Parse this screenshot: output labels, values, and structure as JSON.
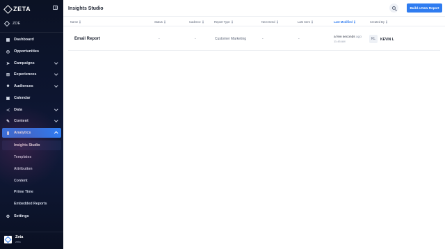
{
  "brand": {
    "name": "ZETA"
  },
  "workspace": {
    "name": "ZOE"
  },
  "sidebar": {
    "items": [
      {
        "label": "Dashboard",
        "icon": "grid-icon"
      },
      {
        "label": "Opportunities",
        "icon": "target-icon"
      },
      {
        "label": "Campaigns",
        "icon": "send-icon"
      },
      {
        "label": "Experiences",
        "icon": "hierarchy-icon"
      },
      {
        "label": "Audiences",
        "icon": "users-icon"
      },
      {
        "label": "Calendar",
        "icon": "calendar-icon"
      },
      {
        "label": "Data",
        "icon": "share-icon"
      },
      {
        "label": "Content",
        "icon": "content-icon"
      },
      {
        "label": "Analytics",
        "icon": "bar-chart-icon"
      },
      {
        "label": "Settings",
        "icon": "gear-icon"
      }
    ],
    "sub_items": [
      {
        "label": "Insights Studio"
      },
      {
        "label": "Templates"
      },
      {
        "label": "Attribution"
      },
      {
        "label": "Content"
      },
      {
        "label": "Prime Time"
      },
      {
        "label": "Embedded Reports"
      }
    ],
    "footer": {
      "name": "Zeta",
      "sub": "zeta"
    }
  },
  "header": {
    "title": "Insights Studio",
    "build_label": "Build a New Report"
  },
  "table": {
    "columns": [
      "Name",
      "Status",
      "Cadence",
      "Report Type",
      "Next Send",
      "Last Sent",
      "Last Modified",
      "Created By"
    ],
    "rows": [
      {
        "name": "Email Report",
        "status": "-",
        "cadence": "-",
        "report_type": "Customer Marketing",
        "next_send": "-",
        "last_sent": "-",
        "modified_main": "a few seconds",
        "modified_ago": "ago",
        "modified_time": "11:45 AM",
        "creator_initials": "KL",
        "creator_name": "KEVIN L"
      }
    ]
  },
  "colors": {
    "accent": "#2f7cf0",
    "sidebar_bg": "#0b1224"
  }
}
